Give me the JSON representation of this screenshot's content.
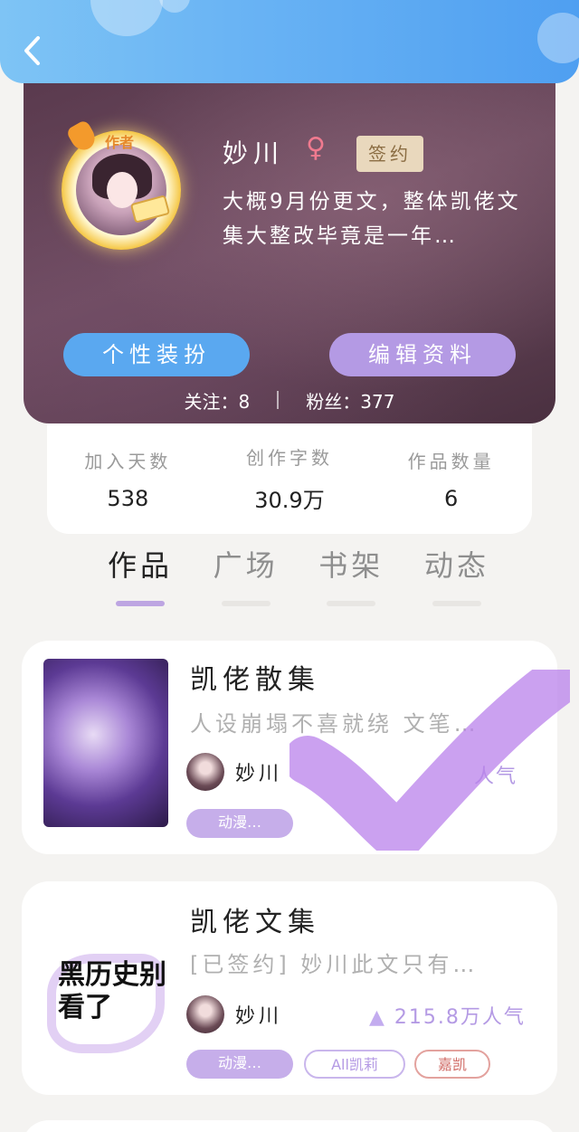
{
  "header": {
    "back_icon": "chevron-left-icon"
  },
  "profile": {
    "name": "妙川",
    "gender_symbol": "♀",
    "signed_badge": "签约",
    "author_tag": "作者",
    "bio": "大概9月份更文，整体凯佬文集大整改毕竟是一年…",
    "buttons": {
      "dress_up": "个性装扮",
      "edit_profile": "编辑资料"
    },
    "follow": {
      "following_label": "关注：",
      "following_count": "8",
      "fans_label": "粉丝：",
      "fans_count": "377"
    }
  },
  "stats": [
    {
      "label": "加入天数",
      "value": "538"
    },
    {
      "label": "创作字数",
      "value": "30.9万"
    },
    {
      "label": "作品数量",
      "value": "6"
    }
  ],
  "tabs": [
    "作品",
    "广场",
    "书架",
    "动态"
  ],
  "works": [
    {
      "title": "凯佬散集",
      "desc": "人设崩塌不喜就绕 文笔…",
      "author": "妙川",
      "popularity": "人气",
      "tags": [
        "动漫…"
      ]
    },
    {
      "title": "凯佬文集",
      "desc": "[已签约] 妙川此文只有…",
      "author": "妙川",
      "popularity": "215.8万人气",
      "tags": [
        "动漫…",
        "All凯莉",
        "嘉凯"
      ],
      "cover_text": "黑历史别看了"
    }
  ],
  "colors": {
    "accent_blue": "#5aa8f0",
    "accent_purple": "#b49ae4",
    "profile_bg": "#5a3a4e"
  }
}
